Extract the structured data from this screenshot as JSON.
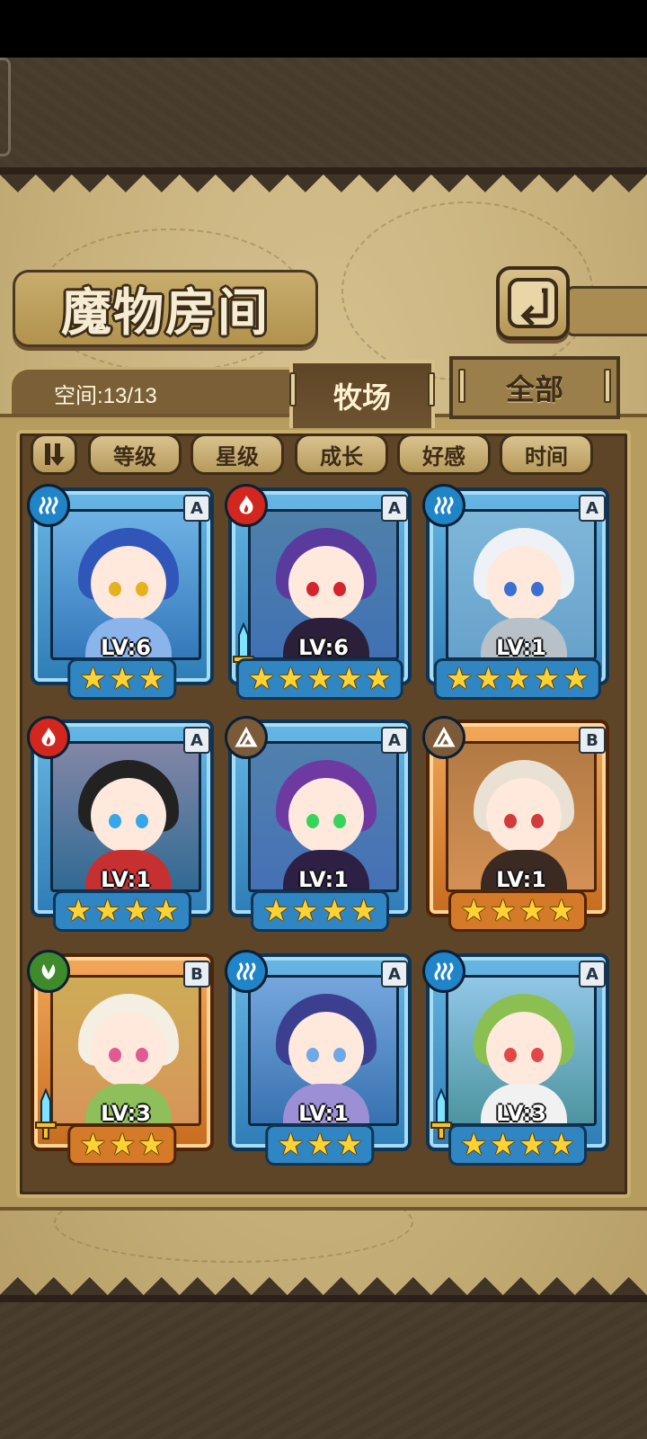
{
  "title": "魔物房间",
  "capacity": "空间:13/13",
  "tabs": [
    {
      "label": "牧场",
      "active": true
    },
    {
      "label": "全部",
      "active": false
    }
  ],
  "sort_buttons": [
    "等级",
    "星级",
    "成长",
    "好感",
    "时间"
  ],
  "colors": {
    "water": "#1f84c8",
    "fire": "#d3261f",
    "earth": "#7b5a3a",
    "wood": "#3f8a2a"
  },
  "monsters": [
    {
      "element": "water",
      "element_icon": "water-wave-icon",
      "rank": "A",
      "level": "LV:6",
      "stars": 3,
      "weapon": false,
      "hair": "#2f56b8",
      "eyes": "#e3b21d",
      "outfit": "#8ab4ea"
    },
    {
      "element": "fire",
      "element_icon": "flame-icon",
      "rank": "A",
      "level": "LV:6",
      "stars": 5,
      "weapon": true,
      "hair": "#5b3a9e",
      "eyes": "#d4242e",
      "outfit": "#2b1f3a"
    },
    {
      "element": "water",
      "element_icon": "water-wave-icon",
      "rank": "A",
      "level": "LV:1",
      "stars": 5,
      "weapon": false,
      "hair": "#eef2f6",
      "eyes": "#3b6fd4",
      "outfit": "#b9c1c8"
    },
    {
      "element": "fire",
      "element_icon": "flame-icon",
      "rank": "A",
      "level": "LV:1",
      "stars": 4,
      "weapon": false,
      "hair": "#222222",
      "eyes": "#35a7e8",
      "outfit": "#c73030"
    },
    {
      "element": "earth",
      "element_icon": "mountain-icon",
      "rank": "A",
      "level": "LV:1",
      "stars": 4,
      "weapon": false,
      "hair": "#6e3aa2",
      "eyes": "#37d35a",
      "outfit": "#2e1f45"
    },
    {
      "element": "earth",
      "element_icon": "mountain-icon",
      "rank": "B",
      "level": "LV:1",
      "stars": 4,
      "weapon": false,
      "hair": "#e8e1d4",
      "eyes": "#d13b3b",
      "outfit": "#3b2a22"
    },
    {
      "element": "wood",
      "element_icon": "leaf-icon",
      "rank": "B",
      "level": "LV:3",
      "stars": 3,
      "weapon": true,
      "hair": "#f4efe2",
      "eyes": "#e25a93",
      "outfit": "#8fbf5a"
    },
    {
      "element": "water",
      "element_icon": "water-wave-icon",
      "rank": "A",
      "level": "LV:1",
      "stars": 3,
      "weapon": false,
      "hair": "#3c3f8f",
      "eyes": "#6fa8e6",
      "outfit": "#9d8fd6"
    },
    {
      "element": "water",
      "element_icon": "water-wave-icon",
      "rank": "A",
      "level": "LV:3",
      "stars": 4,
      "weapon": true,
      "hair": "#8cbf52",
      "eyes": "#e24848",
      "outfit": "#f1f1f1"
    }
  ]
}
